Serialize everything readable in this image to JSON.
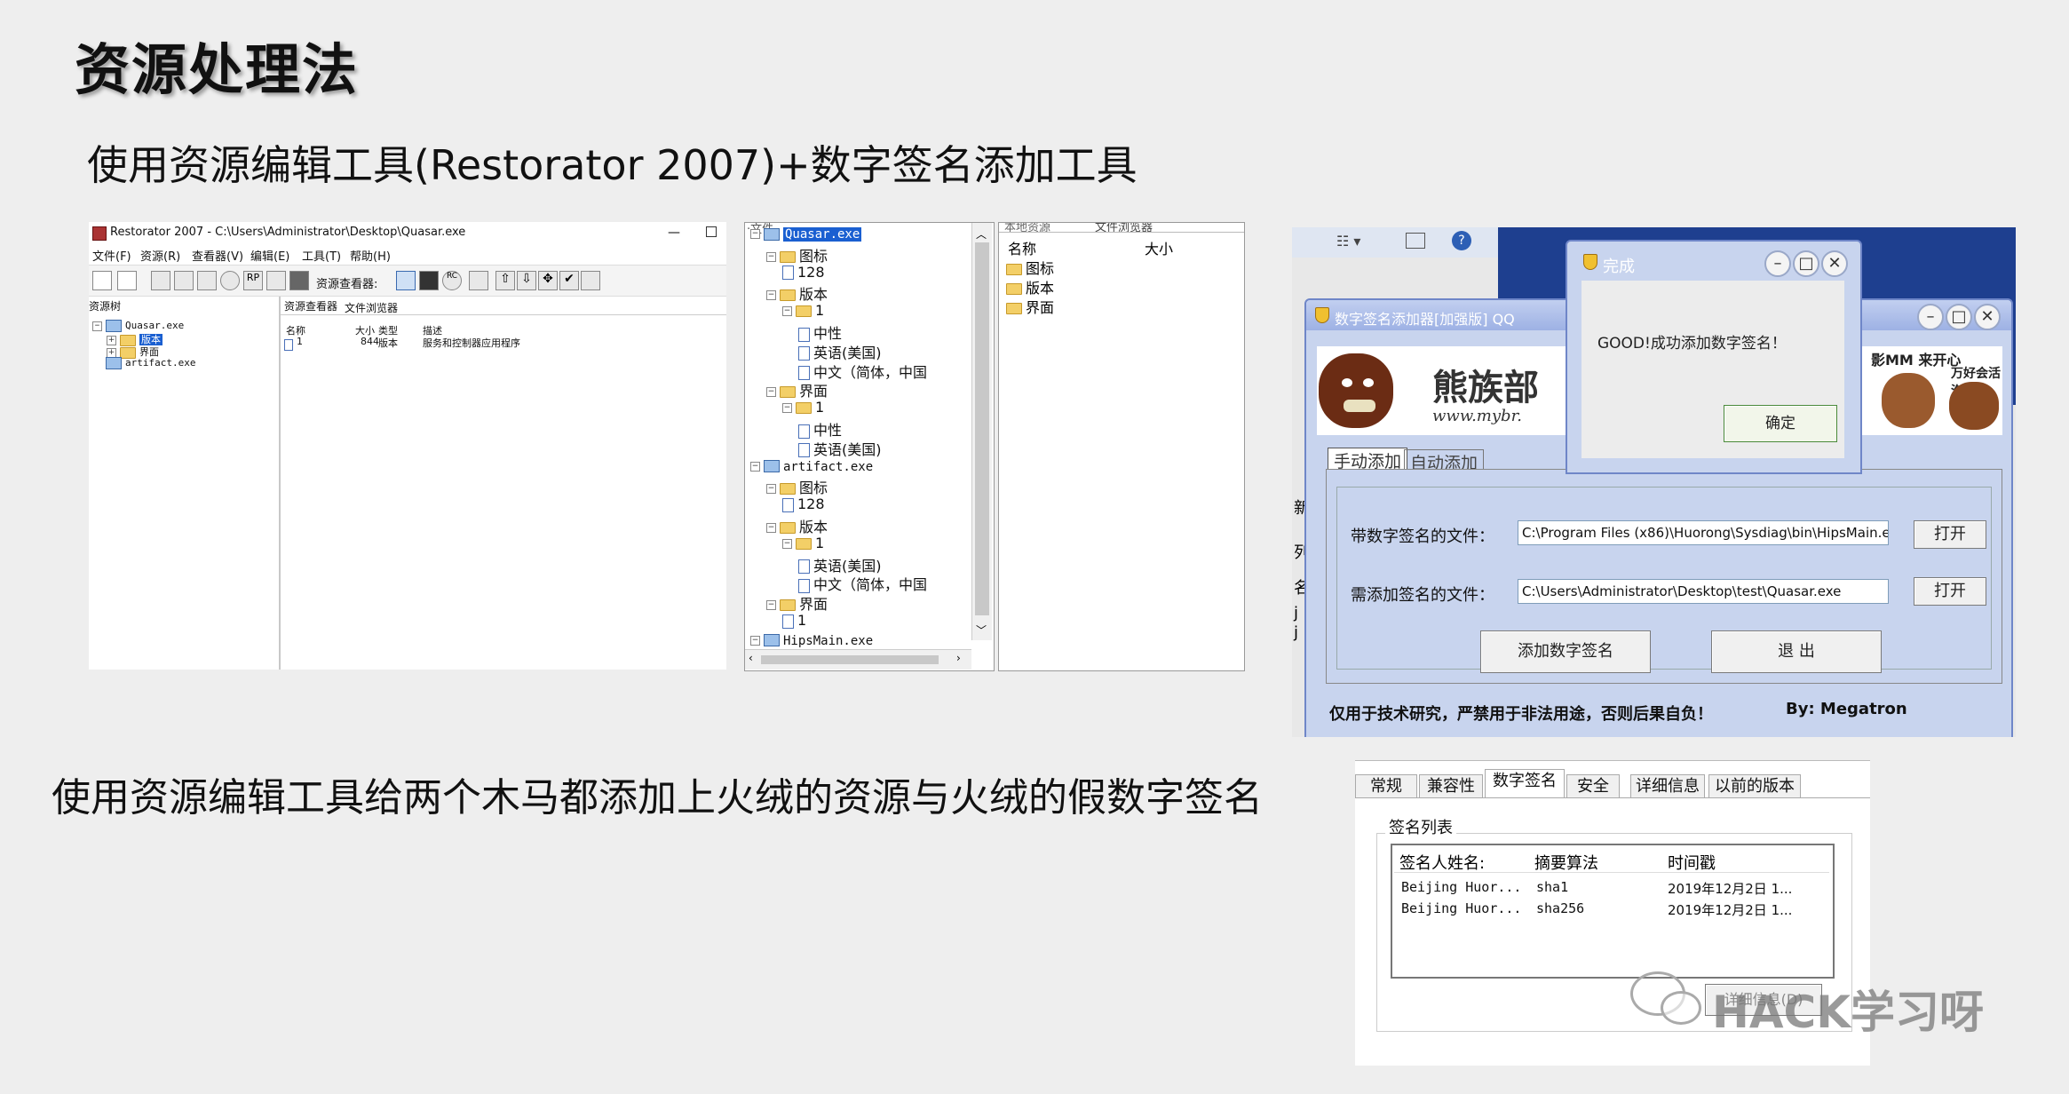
{
  "slide": {
    "title": "资源处理法",
    "subtitle": "使用资源编辑工具(Restorator 2007)+数字签名添加工具",
    "caption": "使用资源编辑工具给两个木马都添加上火绒的资源与火绒的假数字签名",
    "watermark": "HACK学习呀"
  },
  "restorator": {
    "title": "Restorator 2007 - C:\\Users\\Administrator\\Desktop\\Quasar.exe",
    "menu": [
      "文件(F)",
      "资源(R)",
      "查看器(V)",
      "编辑(E)",
      "工具(T)",
      "帮助(H)"
    ],
    "viewer_label": "资源查看器:",
    "left_header": "资源树",
    "tabs": [
      "资源查看器",
      "文件浏览器"
    ],
    "tree": [
      {
        "label": "Quasar.exe"
      },
      {
        "label": "版本",
        "selected": true
      },
      {
        "label": "界面"
      },
      {
        "label": "artifact.exe"
      }
    ],
    "columns": [
      "名称",
      "大小",
      "类型",
      "描述"
    ],
    "row": {
      "name": "1",
      "size": "844",
      "type": "版本",
      "desc": "服务和控制器应用程序"
    }
  },
  "tree_window": {
    "header": "·文件",
    "rows": [
      {
        "label": "Quasar.exe",
        "level": 0,
        "kind": "exe",
        "selected": true
      },
      {
        "label": "图标",
        "level": 1,
        "kind": "folder"
      },
      {
        "label": "128",
        "level": 2,
        "kind": "file"
      },
      {
        "label": "版本",
        "level": 1,
        "kind": "folder"
      },
      {
        "label": "1",
        "level": 2,
        "kind": "folder"
      },
      {
        "label": "中性",
        "level": 3,
        "kind": "file"
      },
      {
        "label": "英语(美国)",
        "level": 3,
        "kind": "file"
      },
      {
        "label": "中文（简体，中国",
        "level": 3,
        "kind": "file"
      },
      {
        "label": "界面",
        "level": 1,
        "kind": "folder"
      },
      {
        "label": "1",
        "level": 2,
        "kind": "folder"
      },
      {
        "label": "中性",
        "level": 3,
        "kind": "file"
      },
      {
        "label": "英语(美国)",
        "level": 3,
        "kind": "file"
      },
      {
        "label": "artifact.exe",
        "level": 0,
        "kind": "exe"
      },
      {
        "label": "图标",
        "level": 1,
        "kind": "folder"
      },
      {
        "label": "128",
        "level": 2,
        "kind": "file"
      },
      {
        "label": "版本",
        "level": 1,
        "kind": "folder"
      },
      {
        "label": "1",
        "level": 2,
        "kind": "folder"
      },
      {
        "label": "英语(美国)",
        "level": 3,
        "kind": "file"
      },
      {
        "label": "中文（简体，中国",
        "level": 3,
        "kind": "file"
      },
      {
        "label": "界面",
        "level": 1,
        "kind": "folder"
      },
      {
        "label": "1",
        "level": 2,
        "kind": "file"
      },
      {
        "label": "HipsMain.exe",
        "level": 0,
        "kind": "exe"
      }
    ]
  },
  "file_browser": {
    "tabs": [
      "本地资源",
      "文件浏览器"
    ],
    "columns": [
      "名称",
      "大小"
    ],
    "items": [
      "图标",
      "版本",
      "界面"
    ]
  },
  "signer": {
    "title": "数字签名添加器[加强版] QQ",
    "banner_text": "熊族部",
    "banner_url": "www.mybr.",
    "banner_right": "影MM 来开心",
    "banner_right2": "万好会活泡",
    "tabs": [
      "手动添加",
      "自动添加"
    ],
    "signed_label": "带数字签名的文件：",
    "signed_value": "C:\\Program Files (x86)\\Huorong\\Sysdiag\\bin\\HipsMain.exe",
    "target_label": "需添加签名的文件：",
    "target_value": "C:\\Users\\Administrator\\Desktop\\test\\Quasar.exe",
    "open": "打开",
    "add": "添加数字签名",
    "exit": "退 出",
    "footer": "仅用于技术研究，严禁用于非法用途，否则后果自负！",
    "by": "By:  Megatron",
    "side_chars": [
      "新",
      "列",
      "名",
      "j",
      "j"
    ]
  },
  "done_dialog": {
    "title": "完成",
    "message": "GOOD!成功添加数字签名！",
    "ok": "确定"
  },
  "properties": {
    "tabs": [
      "常规",
      "兼容性",
      "数字签名",
      "安全",
      "详细信息",
      "以前的版本"
    ],
    "group": "签名列表",
    "columns": [
      "签名人姓名:",
      "摘要算法",
      "时间戳"
    ],
    "rows": [
      {
        "name": "Beijing Huor...",
        "algo": "sha1",
        "time": "2019年12月2日 1..."
      },
      {
        "name": "Beijing Huor...",
        "algo": "sha256",
        "time": "2019年12月2日 1..."
      }
    ],
    "hidden_button": "详细信息(D)"
  }
}
